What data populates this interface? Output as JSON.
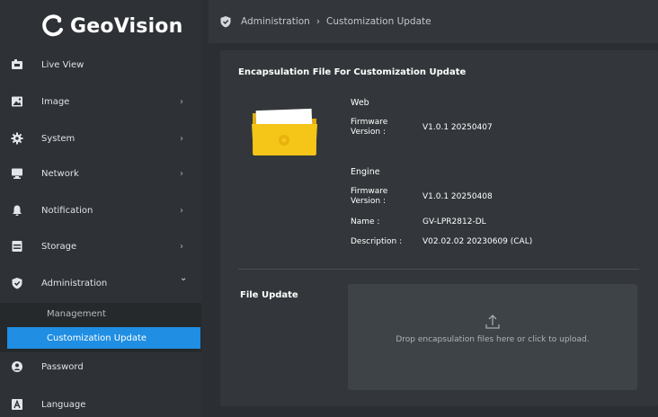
{
  "brand": {
    "name": "GeoVision"
  },
  "sidebar": {
    "items": [
      {
        "label": "Live View",
        "icon": "video-camera-icon",
        "has_chevron": false
      },
      {
        "label": "Image",
        "icon": "image-icon",
        "has_chevron": true
      },
      {
        "label": "System",
        "icon": "gear-icon",
        "has_chevron": true
      },
      {
        "label": "Network",
        "icon": "monitor-icon",
        "has_chevron": true
      },
      {
        "label": "Notification",
        "icon": "bell-icon",
        "has_chevron": true
      },
      {
        "label": "Storage",
        "icon": "storage-icon",
        "has_chevron": true
      },
      {
        "label": "Administration",
        "icon": "shield-icon",
        "has_chevron": true,
        "expanded": true
      },
      {
        "label": "Password",
        "icon": "user-icon",
        "has_chevron": false
      },
      {
        "label": "Language",
        "icon": "language-icon",
        "has_chevron": false
      }
    ],
    "submenu": [
      {
        "label": "Management",
        "active": false
      },
      {
        "label": "Customization Update",
        "active": true
      }
    ],
    "chevron_right": "›",
    "chevron_down": "⌄"
  },
  "breadcrumb": {
    "items": [
      "Administration",
      "Customization Update"
    ],
    "separator": "›"
  },
  "panel": {
    "title": "Encapsulation File For Customization Update",
    "web": {
      "heading": "Web",
      "firmware_label": "Firmware Version :",
      "firmware_value": "V1.0.1 20250407"
    },
    "engine": {
      "heading": "Engine",
      "firmware_label": "Firmware Version :",
      "firmware_value": "V1.0.1 20250408",
      "name_label": "Name :",
      "name_value": "GV-LPR2812-DL",
      "description_label": "Description :",
      "description_value": "V02.02.02 20230609 (CAL)"
    },
    "file_update": {
      "label": "File Update",
      "drop_text": "Drop encapsulation files here or click to upload."
    }
  },
  "colors": {
    "accent": "#1f8ee3",
    "folder": "#f5c518",
    "background": "#2b2f33",
    "panel": "#33373b"
  }
}
